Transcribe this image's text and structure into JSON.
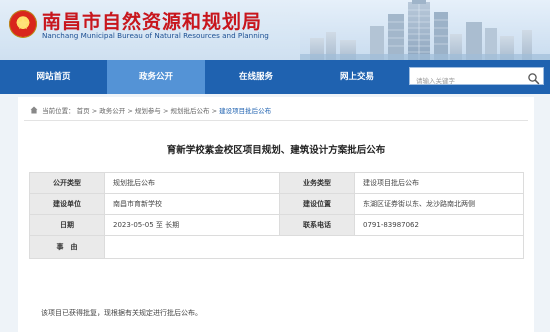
{
  "header": {
    "site_title": "南昌市自然资源和规划局",
    "site_subtitle": "Nanchang Municipal Bureau of Natural Resources and Planning"
  },
  "nav": {
    "items": [
      {
        "label": "网站首页"
      },
      {
        "label": "政务公开"
      },
      {
        "label": "在线服务"
      },
      {
        "label": "网上交易"
      }
    ],
    "active_index": 1
  },
  "search": {
    "placeholder": "请输入关键字",
    "icon": "search-icon"
  },
  "breadcrumb": {
    "prefix": "当前位置：",
    "items": [
      "首页",
      "政务公开",
      "规划参与",
      "规划批后公布",
      "建设项目批后公布"
    ],
    "separator": ">"
  },
  "document": {
    "title": "育新学校紫金校区项目规划、建筑设计方案批后公布",
    "fields": {
      "public_type_label": "公开类型",
      "public_type_value": "规划批后公布",
      "business_type_label": "业务类型",
      "business_type_value": "建设项目批后公布",
      "unit_label": "建设单位",
      "unit_value": "南昌市育新学校",
      "location_label": "建设位置",
      "location_value": "东湖区证券街以东、龙沙路南北两侧",
      "date_label": "日期",
      "date_value": "2023-05-05 至 长期",
      "phone_label": "联系电话",
      "phone_value": "0791-83987062",
      "reason_label": "事　由",
      "reason_value": ""
    },
    "body_text": "该项目已获得批复，现根据有关规定进行批后公布。"
  },
  "colors": {
    "brand_red": "#c8161d",
    "nav_blue": "#1f62b0",
    "nav_active": "#5493d6",
    "label_bg": "#eaeaea"
  }
}
